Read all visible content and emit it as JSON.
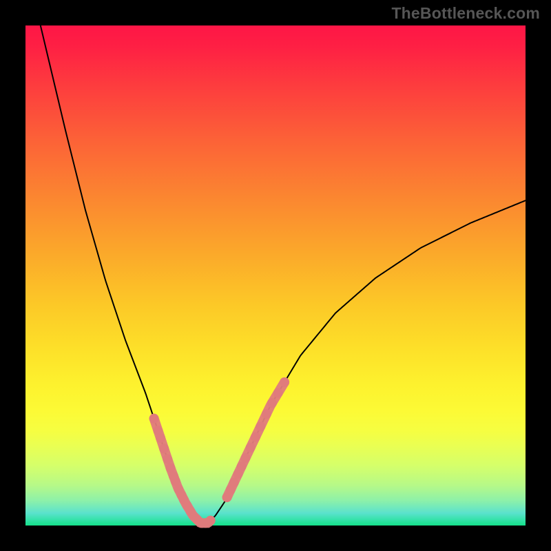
{
  "watermark": "TheBottleneck.com",
  "chart_data": {
    "type": "line",
    "title": "",
    "xlabel": "",
    "ylabel": "",
    "xlim": [
      0,
      100
    ],
    "ylim": [
      0,
      100
    ],
    "series": [
      {
        "name": "curve",
        "color": "#000000",
        "x": [
          3,
          8,
          12,
          16,
          20,
          24,
          27,
          29,
          30.5,
          32,
          33.5,
          35,
          36.5,
          38,
          40,
          44,
          49,
          55,
          62,
          70,
          79,
          89,
          100
        ],
        "values": [
          100,
          79,
          63,
          49,
          37,
          26.5,
          17.5,
          11.5,
          7.5,
          4.5,
          2,
          0.5,
          0.5,
          2,
          5,
          13.5,
          24,
          34,
          42.5,
          49.5,
          55.5,
          60.5,
          65
        ]
      }
    ],
    "markers": {
      "color": "#e07b7c",
      "radius_px": 7,
      "segments": [
        {
          "x": [
            25.7,
            26.5,
            27.0,
            27.7,
            28.4,
            29.0,
            29.6,
            30.0,
            30.6,
            31.2,
            31.7,
            32.3,
            33.0,
            33.7,
            34.3,
            35.3,
            36.0,
            37.0
          ]
        },
        {
          "x": [
            40.3,
            41.0,
            41.7,
            42.5,
            43.2,
            44.0,
            45.0,
            46.0,
            47.0,
            48.2,
            49.3,
            50.5,
            51.8
          ]
        }
      ]
    }
  }
}
